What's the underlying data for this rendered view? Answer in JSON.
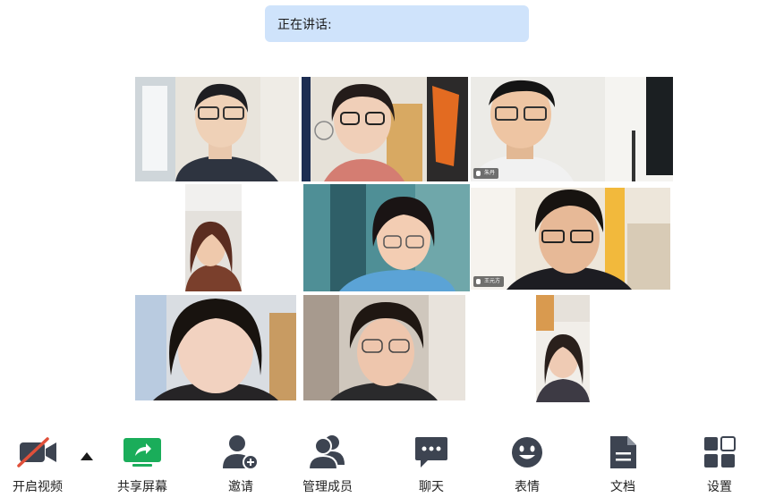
{
  "speaking": {
    "label": "正在讲话:"
  },
  "participants": [
    {
      "tile": "participant-1"
    },
    {
      "tile": "participant-2"
    },
    {
      "tile": "participant-3",
      "name": "朱丹"
    },
    {
      "tile": "participant-4"
    },
    {
      "tile": "participant-5"
    },
    {
      "tile": "participant-6",
      "name": "王元方"
    },
    {
      "tile": "participant-7"
    },
    {
      "tile": "participant-8"
    },
    {
      "tile": "participant-9"
    }
  ],
  "toolbar": {
    "video": {
      "label": "开启视频",
      "icon": "video-off-icon"
    },
    "share": {
      "label": "共享屏幕",
      "icon": "share-screen-icon"
    },
    "invite": {
      "label": "邀请",
      "icon": "add-person-icon"
    },
    "members": {
      "label": "管理成员",
      "icon": "members-icon"
    },
    "chat": {
      "label": "聊天",
      "icon": "chat-icon"
    },
    "emoji": {
      "label": "表情",
      "icon": "emoji-icon"
    },
    "docs": {
      "label": "文档",
      "icon": "document-icon"
    },
    "settings": {
      "label": "设置",
      "icon": "settings-icon"
    }
  },
  "colors": {
    "speaking_bg": "#cfe3fb",
    "share_green": "#1aad5a",
    "video_off_red": "#e0503a",
    "icon_dark": "#3d4451"
  }
}
